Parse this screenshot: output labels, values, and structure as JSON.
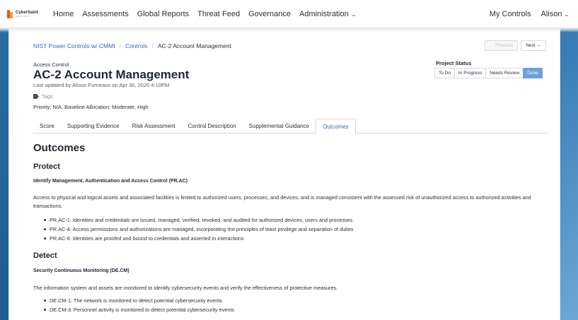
{
  "nav": {
    "logo_text": "CyberSaint",
    "logo_sub": "SECURITY",
    "links": [
      "Home",
      "Assessments",
      "Global Reports",
      "Threat Feed",
      "Governance",
      "Administration"
    ],
    "right_links": [
      "My Controls",
      "Alison"
    ]
  },
  "breadcrumb": [
    "NIST Power Controls w/ CMMI",
    "Controls",
    "AC-2 Account Management"
  ],
  "pager": {
    "previous": "← Previous",
    "next": "Next →"
  },
  "control": {
    "category": "Access Control",
    "title": "AC-2 Account Management",
    "updated": "Last updated by Alison Furneaux on Apr 30, 2020 4:10PM",
    "tags_label": "Tags",
    "priority": "Priority: N/A, Baseline Allocation: Moderate, High"
  },
  "project_status": {
    "label": "Project Status",
    "options": [
      "To Do",
      "In Progress",
      "Needs Review",
      "Done"
    ],
    "selected": "Done"
  },
  "tabs": [
    "Score",
    "Supporting Evidence",
    "Risk Assessment",
    "Control Description",
    "Supplemental Guidance",
    "Outcomes"
  ],
  "active_tab": "Outcomes",
  "outcomes": {
    "heading": "Outcomes",
    "sections": [
      {
        "title": "Protect",
        "subtitle": "Identify Management, Authentication and Access Control (PR.AC)",
        "description": "Access to physical and logical assets and associated facilities is limited to authorized users, processes, and devices, and is managed consistent with the assessed risk of unauthorized access to authorized activities and transactions.",
        "items": [
          "PR.AC-1: Identities and credentials are issued, managed, verified, revoked, and audited for authorized devices, users and processes",
          "PR.AC-4: Access permissions and authorizations are managed, incorporating the principles of least privilege and separation of duties",
          "PR.AC-6: Identities are proofed and bound to credentials and asserted in interactions"
        ]
      },
      {
        "title": "Detect",
        "subtitle": "Security Continuous Monitoring (DE.CM)",
        "description": "The information system and assets are monitored to identify cybersecurity events and verify the effectiveness of protective measures.",
        "items": [
          "DE.CM-1: The network is monitored to detect potential cybersecurity events",
          "DE.CM-3: Personnel activity is monitored to detect potential cybersecurity events"
        ]
      }
    ]
  },
  "colors": {
    "accent": "#2b6cc4",
    "status_active": "#6fa0dc",
    "background": "#2a6fa8"
  }
}
